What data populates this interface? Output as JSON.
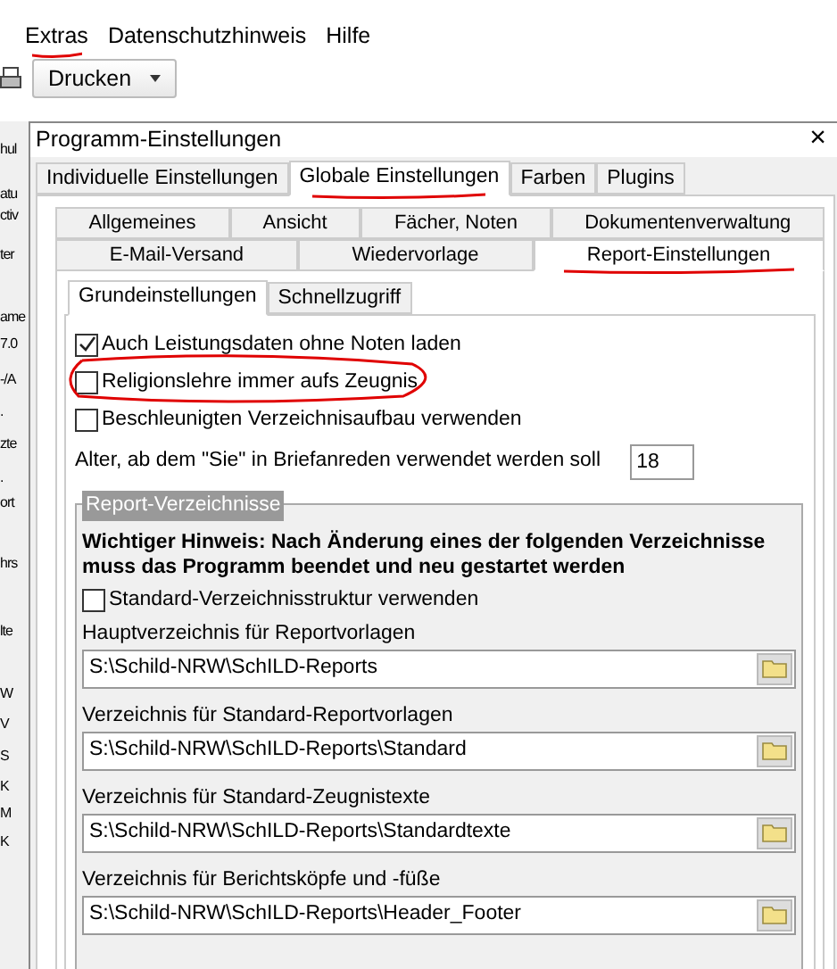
{
  "menu": [
    {
      "label": "Extras",
      "marked": true
    },
    {
      "label": "Datenschutzhinweis",
      "marked": false
    },
    {
      "label": "Hilfe",
      "marked": false
    }
  ],
  "toolbar": {
    "print_button": "Drucken"
  },
  "background_app": {
    "fragments": [
      "hul",
      "atu",
      "ctiv",
      "ter",
      "ame",
      "7.0",
      "-/A",
      ".",
      "zte",
      ".",
      "ort",
      "hrs",
      "lte",
      "W",
      "V",
      "S",
      "K",
      "M",
      "K"
    ]
  },
  "dialog": {
    "title": "Programm-Einstellungen",
    "close": "×",
    "tabs": [
      {
        "label": "Individuelle Einstellungen",
        "selected": false,
        "marked": false
      },
      {
        "label": "Globale Einstellungen",
        "selected": true,
        "marked": true
      },
      {
        "label": "Farben",
        "selected": false,
        "marked": false
      },
      {
        "label": "Plugins",
        "selected": false,
        "marked": false
      }
    ],
    "section_tabs_row1": [
      {
        "label": "Allgemeines",
        "selected": false,
        "marked": false
      },
      {
        "label": "Ansicht",
        "selected": false,
        "marked": false
      },
      {
        "label": "Fächer, Noten",
        "selected": false,
        "marked": false
      },
      {
        "label": "Dokumentenverwaltung",
        "selected": false,
        "marked": false
      }
    ],
    "section_tabs_row2": [
      {
        "label": "E-Mail-Versand",
        "selected": false,
        "marked": false
      },
      {
        "label": "Wiedervorlage",
        "selected": false,
        "marked": false
      },
      {
        "label": "Report-Einstellungen",
        "selected": true,
        "marked": true
      }
    ],
    "sub_tabs": [
      {
        "label": "Grundeinstellungen",
        "selected": true
      },
      {
        "label": "Schnellzugriff",
        "selected": false
      }
    ],
    "options": [
      {
        "label": "Auch Leistungsdaten ohne Noten laden",
        "checked": true,
        "marked": false
      },
      {
        "label": "Religionslehre immer aufs Zeugnis",
        "checked": false,
        "marked": true
      },
      {
        "label": "Beschleunigten Verzeichnisaufbau verwenden",
        "checked": false,
        "marked": false
      }
    ],
    "age_field": {
      "label": "Alter, ab dem \"Sie\" in Briefanreden verwendet werden soll",
      "value": "18"
    },
    "group": {
      "title": "Report-Verzeichnisse",
      "notice": "Wichtiger Hinweis: Nach Änderung eines der folgenden Verzeichnisse muss das Programm beendet und neu  gestartet werden",
      "standard_structure": {
        "label": "Standard-Verzeichnisstruktur verwenden",
        "checked": false
      },
      "paths": [
        {
          "label": "Hauptverzeichnis für Reportvorlagen",
          "value": "S:\\Schild-NRW\\SchILD-Reports"
        },
        {
          "label": "Verzeichnis für Standard-Reportvorlagen",
          "value": "S:\\Schild-NRW\\SchILD-Reports\\Standard"
        },
        {
          "label": "Verzeichnis für Standard-Zeugnistexte",
          "value": "S:\\Schild-NRW\\SchILD-Reports\\Standardtexte"
        },
        {
          "label": "Verzeichnis für Berichtsköpfe und -füße",
          "value": "S:\\Schild-NRW\\SchILD-Reports\\Header_Footer"
        }
      ]
    }
  }
}
